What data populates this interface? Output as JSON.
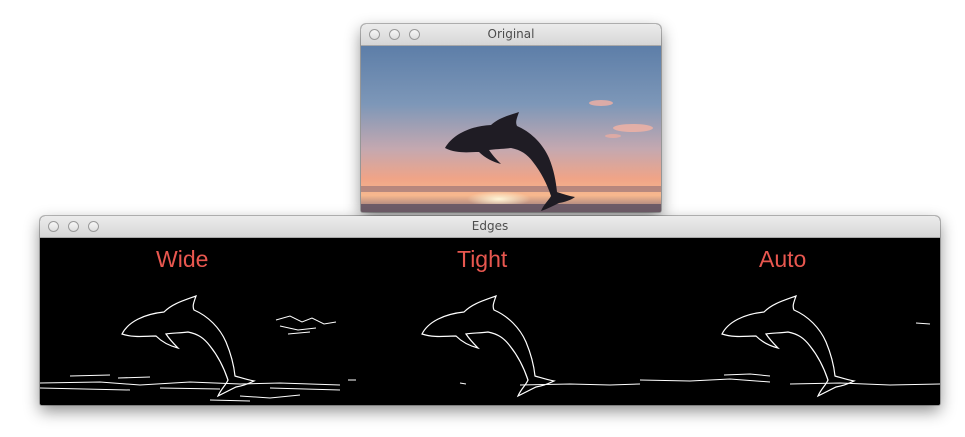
{
  "windows": {
    "original": {
      "title": "Original"
    },
    "edges": {
      "title": "Edges",
      "panel_labels": [
        "Wide",
        "Tight",
        "Auto"
      ]
    }
  },
  "colors": {
    "label_text": "#e8574f",
    "edge_lines": "#ffffff",
    "edge_background": "#000000",
    "sky_top": "#5e7fa8",
    "sunset": "#f6a07a"
  }
}
